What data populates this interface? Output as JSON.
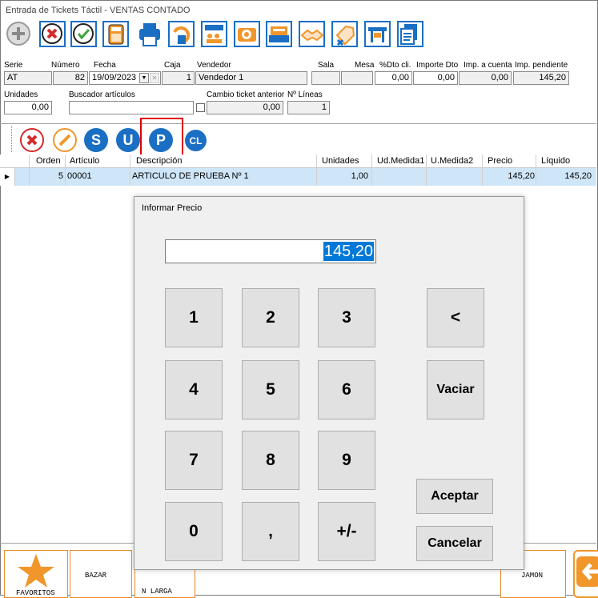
{
  "window": {
    "title": "Entrada de Tickets Táctil - VENTAS CONTADO"
  },
  "toolbar": {
    "icons": [
      "add-icon",
      "cancel-icon",
      "accept-icon",
      "calculator-icon",
      "printer-icon",
      "return-icon",
      "group-icon",
      "camera-icon",
      "cash-register-icon",
      "handshake-icon",
      "discount-tag-icon",
      "table-icon",
      "document-copy-icon"
    ]
  },
  "header": {
    "serie_label": "Serie",
    "serie_value": "AT",
    "numero_label": "Número",
    "numero_value": "82",
    "fecha_label": "Fecha",
    "fecha_value": "19/09/2023",
    "caja_label": "Caja",
    "caja_value": "1",
    "vendedor_label": "Vendedor",
    "vendedor_value": "Vendedor 1",
    "sala_label": "Sala",
    "sala_value": "",
    "mesa_label": "Mesa",
    "mesa_value": "",
    "dto_label": "%Dto cli.",
    "dto_value": "0,00",
    "importe_dto_label": "Importe Dto",
    "importe_dto_value": "0,00",
    "imp_cuenta_label": "Imp. a cuenta",
    "imp_cuenta_value": "0,00",
    "imp_pendiente_label": "Imp. pendiente",
    "imp_pendiente_value": "145,20",
    "unidades_label": "Unidades",
    "unidades_value": "0,00",
    "buscador_label": "Buscador artículos",
    "buscador_value": "",
    "cambio_label": "Cambio ticket anterior",
    "cambio_value": "0,00",
    "nlineas_label": "Nº Líneas",
    "nlineas_value": "1"
  },
  "actions": {
    "s": "S",
    "u": "U",
    "p": "P",
    "cl": "CL"
  },
  "grid": {
    "columns": [
      "Orden",
      "Artículo",
      "Descripción",
      "Unidades",
      "Ud.Medida1",
      "U.Medida2",
      "Precio",
      "Líquido"
    ],
    "rows": [
      {
        "orden": "5",
        "articulo": "00001",
        "descripcion": "ARTICULO DE PRUEBA Nº 1",
        "unidades": "1,00",
        "ud1": "",
        "ud2": "",
        "precio": "145,20",
        "liquido": "145,20"
      }
    ]
  },
  "dialog": {
    "title": "Informar Precio",
    "value": "145,20",
    "keys": [
      "1",
      "2",
      "3",
      "4",
      "5",
      "6",
      "7",
      "8",
      "9",
      "0",
      ",",
      "+/-"
    ],
    "backspace": "<",
    "clear": "Vaciar",
    "accept": "Aceptar",
    "cancel": "Cancelar"
  },
  "bottom": {
    "favorites": "FAVORITOS",
    "bazar": "BAZAR",
    "n_larga": "N LARGA",
    "jamon": "JAMON"
  },
  "colors": {
    "accent_blue": "#1a6fc4",
    "red": "#d42a2a",
    "orange": "#f0962a",
    "selection": "#0078d7",
    "row_highlight": "#cfe6f8"
  }
}
